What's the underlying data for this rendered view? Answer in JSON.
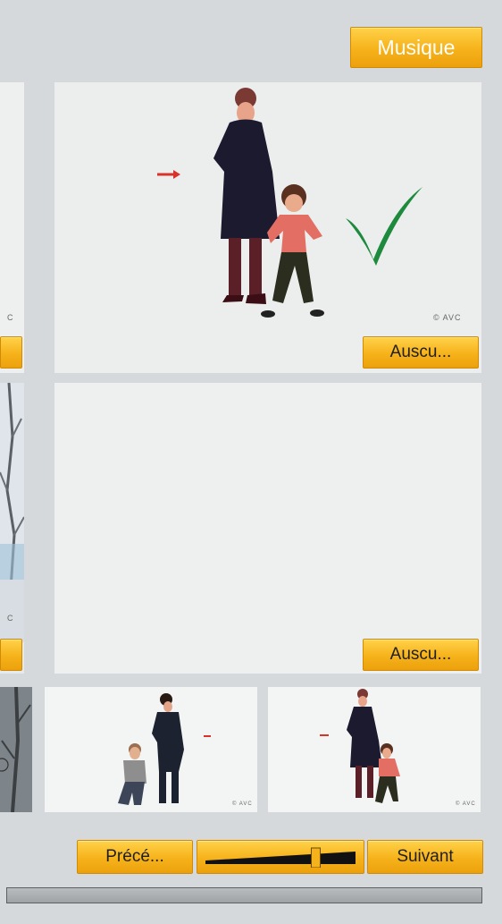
{
  "toolbar": {
    "music_button": "Musique"
  },
  "main_panels": [
    {
      "listen_button": "Auscu...",
      "credit": "© AVC"
    },
    {
      "listen_button": "Auscu..."
    }
  ],
  "left_partial": {
    "credit_1": "C",
    "credit_2": "C"
  },
  "thumbnails": [
    {
      "credit": "© AVC"
    },
    {
      "credit": "© AVC"
    }
  ],
  "navigation": {
    "previous_button": "Précé...",
    "next_button": "Suivant",
    "slider_position": 0.75
  },
  "colors": {
    "accent": "#f6b21a",
    "background": "#d6d9db",
    "panel": "#eceeee",
    "check": "#1e8a3e",
    "arrow": "#d8322a"
  }
}
